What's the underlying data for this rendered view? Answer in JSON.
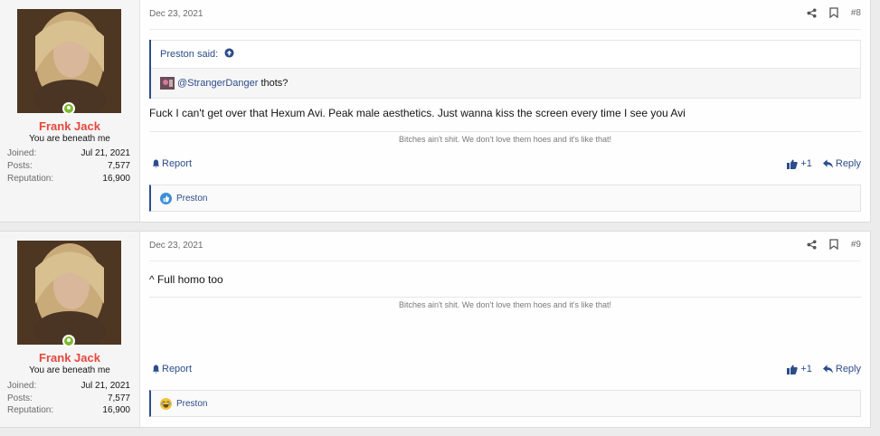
{
  "posts": [
    {
      "user": {
        "name": "Frank Jack",
        "title": "You are beneath me",
        "joined_label": "Joined:",
        "joined": "Jul 21, 2021",
        "posts_label": "Posts:",
        "posts": "7,577",
        "rep_label": "Reputation:",
        "reputation": "16,900"
      },
      "date": "Dec 23, 2021",
      "number": "#8",
      "quote": {
        "author": "Preston said:",
        "mention": "@StrangerDanger",
        "text": "thots?"
      },
      "body": "Fuck I can't get over that Hexum Avi. Peak male aesthetics. Just wanna kiss the screen every time I see you Avi",
      "signature": "Bitches ain't shit. We don't love them hoes and it's like that!",
      "report_label": "Report",
      "like_label": "+1",
      "reply_label": "Reply",
      "reaction_user": "Preston",
      "reaction_icon": "like-reaction-icon"
    },
    {
      "user": {
        "name": "Frank Jack",
        "title": "You are beneath me",
        "joined_label": "Joined:",
        "joined": "Jul 21, 2021",
        "posts_label": "Posts:",
        "posts": "7,577",
        "rep_label": "Reputation:",
        "reputation": "16,900"
      },
      "date": "Dec 23, 2021",
      "number": "#9",
      "body": "^ Full homo too",
      "signature": "Bitches ain't shit. We don't love them hoes and it's like that!",
      "report_label": "Report",
      "like_label": "+1",
      "reply_label": "Reply",
      "reaction_user": "Preston",
      "reaction_icon": "laugh-reaction-icon"
    }
  ],
  "colors": {
    "accent": "#2c4d8a",
    "username": "#e4493c",
    "online": "#7dba32"
  }
}
